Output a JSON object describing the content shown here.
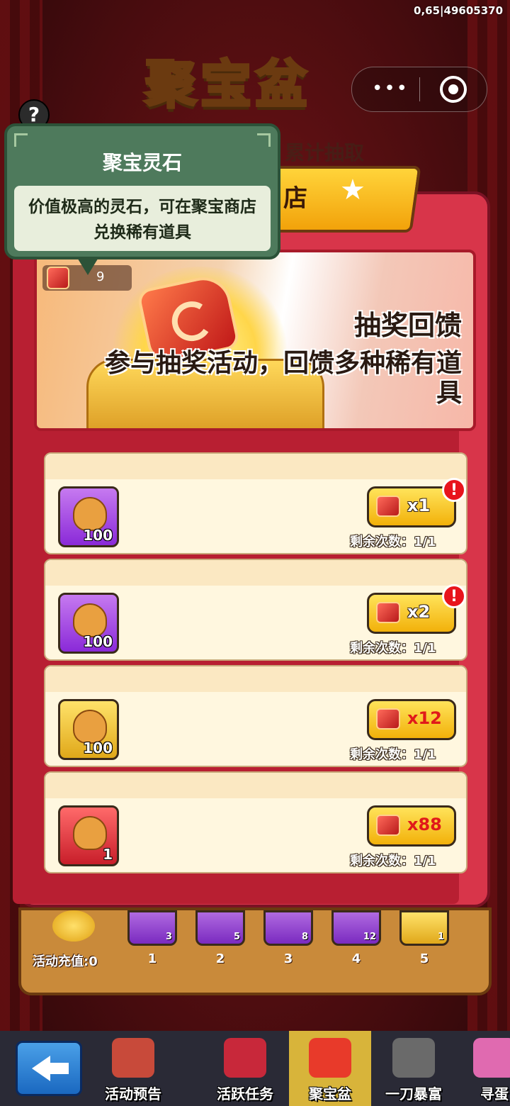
{
  "status": {
    "id_text": "0,65|49605370"
  },
  "title": {
    "game_title": "聚宝盆",
    "cumulative_label": "累计抽取",
    "shop_label": "店"
  },
  "tooltip": {
    "title": "聚宝灵石",
    "description": "价值极高的灵石，可在聚宝商店兑换稀有道具"
  },
  "currency": {
    "icon": "spirit-stone-icon",
    "value": "9"
  },
  "banner": {
    "title": "抽奖回馈",
    "description": "参与抽奖活动，回馈多种稀有道具"
  },
  "shop_items": [
    {
      "icon": "money-bag-icon",
      "icon_color": "purple",
      "count": "100",
      "cost": "x1",
      "cost_color": "white",
      "remaining": "剩余次数：1/1",
      "alert": "!"
    },
    {
      "icon": "money-bag-icon",
      "icon_color": "purple",
      "count": "100",
      "cost": "x2",
      "cost_color": "white",
      "remaining": "剩余次数：1/1",
      "alert": "!"
    },
    {
      "icon": "treasure-chest-icon",
      "icon_color": "gold",
      "count": "100",
      "cost": "x12",
      "cost_color": "red",
      "remaining": "剩余次数：1/1",
      "alert": ""
    },
    {
      "icon": "character-icon",
      "icon_color": "red",
      "count": "1",
      "cost": "x88",
      "cost_color": "red",
      "remaining": "剩余次数：1/1",
      "alert": ""
    }
  ],
  "progress": {
    "recharge_label": "活动充值:0",
    "steps": [
      {
        "count": "3",
        "num": "1",
        "color": "purple"
      },
      {
        "count": "5",
        "num": "2",
        "color": "purple"
      },
      {
        "count": "8",
        "num": "3",
        "color": "purple"
      },
      {
        "count": "12",
        "num": "4",
        "color": "purple"
      },
      {
        "count": "1",
        "num": "5",
        "color": "gold"
      }
    ]
  },
  "nav": {
    "back_icon": "back-arrow-icon",
    "items": [
      {
        "label": "活动预告",
        "icon": "calendar-icon",
        "color": "#c84a3a",
        "active": false
      },
      {
        "label": "活跃任务",
        "icon": "task-icon",
        "color": "#c8283a",
        "active": false
      },
      {
        "label": "聚宝盆",
        "icon": "treasure-bowl-icon",
        "color": "#e83a2a",
        "active": true
      },
      {
        "label": "一刀暴富",
        "icon": "knife-icon",
        "color": "#6a6a6a",
        "active": false
      },
      {
        "label": "寻蛋",
        "icon": "egg-icon",
        "color": "#e06ab0",
        "active": false
      }
    ]
  },
  "colors": {
    "modal_red": "#d8354a",
    "tooltip_green": "#4e7a5c",
    "button_yellow": "#f2b10a",
    "nav_active": "#d8b43a"
  }
}
